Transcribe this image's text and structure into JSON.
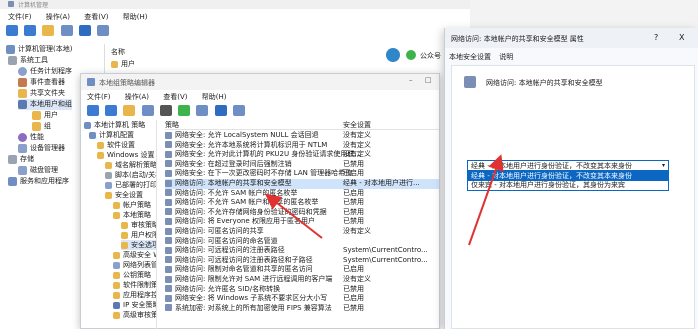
{
  "bg_window": {
    "title": "计算机管理",
    "menu": [
      "文件(F)",
      "操作(A)",
      "查看(V)",
      "帮助(H)"
    ],
    "tree": [
      {
        "label": "计算机管理(本地)",
        "icon": "computer-icon",
        "indent": 0
      },
      {
        "label": "系统工具",
        "icon": "tools-icon",
        "indent": 1
      },
      {
        "label": "任务计划程序",
        "icon": "clock-icon",
        "indent": 2
      },
      {
        "label": "事件查看器",
        "icon": "event-icon",
        "indent": 2
      },
      {
        "label": "共享文件夹",
        "icon": "folder-icon",
        "indent": 2
      },
      {
        "label": "本地用户和组",
        "icon": "users-icon",
        "indent": 2
      },
      {
        "label": "用户",
        "icon": "folder-icon",
        "indent": 3
      },
      {
        "label": "组",
        "icon": "folder-icon",
        "indent": 3
      },
      {
        "label": "性能",
        "icon": "performance-icon",
        "indent": 2
      },
      {
        "label": "设备管理器",
        "icon": "device-icon",
        "indent": 2
      },
      {
        "label": "存储",
        "icon": "storage-icon",
        "indent": 1
      },
      {
        "label": "磁盘管理",
        "icon": "disk-icon",
        "indent": 2
      },
      {
        "label": "服务和应用程序",
        "icon": "services-icon",
        "indent": 1
      }
    ],
    "list_header": "名称",
    "list_item": "用户",
    "right_pane_text": "公众号"
  },
  "gp_window": {
    "title": "本地组策略编辑器",
    "menu": [
      "文件(F)",
      "操作(A)",
      "查看(V)",
      "帮助(H)"
    ],
    "tree": [
      {
        "label": "本地计算机 策略",
        "indent": 0
      },
      {
        "label": "计算机配置",
        "indent": 1
      },
      {
        "label": "软件设置",
        "indent": 2
      },
      {
        "label": "Windows 设置",
        "indent": 2
      },
      {
        "label": "域名解析策略",
        "indent": 3
      },
      {
        "label": "脚本(启动/关机)",
        "indent": 3
      },
      {
        "label": "已部署的打印机",
        "indent": 3
      },
      {
        "label": "安全设置",
        "indent": 3
      },
      {
        "label": "帐户策略",
        "indent": 4
      },
      {
        "label": "本地策略",
        "indent": 4
      },
      {
        "label": "审核策略",
        "indent": 5
      },
      {
        "label": "用户权限分配",
        "indent": 5
      },
      {
        "label": "安全选项",
        "indent": 5
      },
      {
        "label": "高级安全 Windows Defender 防火墙",
        "indent": 4
      },
      {
        "label": "网络列表管理器策略",
        "indent": 4
      },
      {
        "label": "公钥策略",
        "indent": 4
      },
      {
        "label": "软件限制策略",
        "indent": 4
      },
      {
        "label": "应用程序控制策略",
        "indent": 4
      },
      {
        "label": "IP 安全策略",
        "indent": 4
      },
      {
        "label": "高级审核策略配置",
        "indent": 4
      }
    ],
    "columns": {
      "policy": "策略",
      "setting": "安全设置"
    },
    "rows": [
      {
        "policy": "网络安全: 允许 LocalSystem NULL 会话回退",
        "setting": "没有定义"
      },
      {
        "policy": "网络安全: 允许本地系统将计算机标识用于 NTLM",
        "setting": "没有定义"
      },
      {
        "policy": "网络安全: 允许对此计算机的 PKU2U 身份验证请求使用联...",
        "setting": "没有定义"
      },
      {
        "policy": "网络安全: 在超过登录时间后强制注销",
        "setting": "已禁用"
      },
      {
        "policy": "网络安全: 在下一次更改密码时不存储 LAN 管理器哈希值",
        "setting": "已启用"
      },
      {
        "policy": "网络访问: 本地帐户的共享和安全模型",
        "setting": "经典 - 对本地用户进行..."
      },
      {
        "policy": "网络访问: 不允许 SAM 帐户的匿名枚举",
        "setting": "已启用"
      },
      {
        "policy": "网络访问: 不允许 SAM 帐户和共享的匿名枚举",
        "setting": "已禁用"
      },
      {
        "policy": "网络访问: 不允许存储网络身份验证的密码和凭据",
        "setting": "已禁用"
      },
      {
        "policy": "网络访问: 将 Everyone 权限应用于匿名用户",
        "setting": "已禁用"
      },
      {
        "policy": "网络访问: 可匿名访问的共享",
        "setting": "没有定义"
      },
      {
        "policy": "网络访问: 可匿名访问的命名管道",
        "setting": ""
      },
      {
        "policy": "网络访问: 可远程访问的注册表路径",
        "setting": "System\\CurrentContro..."
      },
      {
        "policy": "网络访问: 可远程访问的注册表路径和子路径",
        "setting": "System\\CurrentContro..."
      },
      {
        "policy": "网络访问: 限制对命名管道和共享的匿名访问",
        "setting": "已启用"
      },
      {
        "policy": "网络访问: 限制允许对 SAM 进行远程调用的客户端",
        "setting": "没有定义"
      },
      {
        "policy": "网络访问: 允许匿名 SID/名称转换",
        "setting": "已禁用"
      },
      {
        "policy": "网络安全: 将 Windows 子系统不要求区分大小写",
        "setting": "已启用"
      },
      {
        "policy": "系统加密: 对系统上的所有加密使用 FIPS 兼容算法",
        "setting": "已禁用"
      }
    ],
    "selected_index": 5
  },
  "props_dialog": {
    "title": "网络访问: 本地帐户的共享和安全模型 属性",
    "help_btn": "?",
    "close_btn": "X",
    "tabs": [
      "本地安全设置",
      "说明"
    ],
    "policy_name": "网络访问: 本地帐户的共享和安全模型",
    "dropdown_value": "经典 - 对本地用户进行身份验证，不改变其本来身份",
    "options": [
      "经典 - 对本地用户进行身份验证，不改变其本来身份",
      "仅来宾 - 对本地用户进行身份验证，其身份为来宾"
    ],
    "highlighted_option": 1
  },
  "colors": {
    "accent": "#0b67c2",
    "arrow": "#e03232",
    "selection": "#cfe3fb",
    "dialog_bg": "#f7f9fc"
  }
}
